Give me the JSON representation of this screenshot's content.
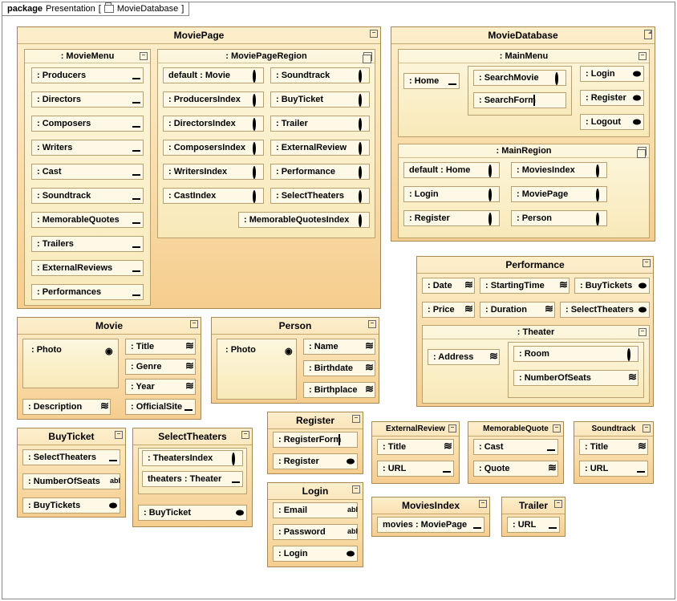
{
  "package": {
    "keyword": "package",
    "name": "Presentation",
    "context": "MovieDatabase"
  },
  "moviePage": {
    "title": "MoviePage",
    "menu": {
      "title": ": MovieMenu",
      "items": [
        ": Producers",
        ": Directors",
        ": Composers",
        ": Writers",
        ": Cast",
        ": Soundtrack",
        ": MemorableQuotes",
        ": Trailers",
        ": ExternalReviews",
        ": Performances"
      ]
    },
    "region": {
      "title": ": MoviePageRegion",
      "col1": [
        "default : Movie",
        ": ProducersIndex",
        ": DirectorsIndex",
        ": ComposersIndex",
        ": WritersIndex",
        ": CastIndex"
      ],
      "col2": [
        ": Soundtrack",
        ": BuyTicket",
        ": Trailer",
        ": ExternalReview",
        ": Performance",
        ": SelectTheaters",
        ": MemorableQuotesIndex"
      ]
    }
  },
  "movieDatabase": {
    "title": "MovieDatabase",
    "mainMenu": {
      "title": ": MainMenu",
      "home": ": Home",
      "searchMovie": ": SearchMovie",
      "searchForm": ": SearchForm",
      "right": [
        ": Login",
        ": Register",
        ": Logout"
      ]
    },
    "mainRegion": {
      "title": ": MainRegion",
      "col1": [
        "default : Home",
        ": Login",
        ": Register"
      ],
      "col2": [
        ": MoviesIndex",
        ": MoviePage",
        ": Person"
      ]
    }
  },
  "movie": {
    "title": "Movie",
    "photo": ": Photo",
    "title2": ": Title",
    "genre": ": Genre",
    "year": ": Year",
    "desc": ": Description",
    "site": ": OfficialSite"
  },
  "person": {
    "title": "Person",
    "photo": ": Photo",
    "name": ": Name",
    "birthdate": ": Birthdate",
    "birthplace": ": Birthplace"
  },
  "performance": {
    "title": "Performance",
    "date": ": Date",
    "start": ": StartingTime",
    "buy": ": BuyTickets",
    "price": ": Price",
    "duration": ": Duration",
    "select": ": SelectTheaters",
    "theater": {
      "title": ": Theater",
      "address": ": Address",
      "room": ": Room",
      "seats": ": NumberOfSeats"
    }
  },
  "buyTicket": {
    "title": "BuyTicket",
    "select": ": SelectTheaters",
    "seats": ": NumberOfSeats",
    "buy": ": BuyTickets"
  },
  "selectTheaters": {
    "title": "SelectTheaters",
    "index": ": TheatersIndex",
    "theaters": "theaters : Theater",
    "buy": ": BuyTicket"
  },
  "register": {
    "title": "Register",
    "form": ": RegisterForm",
    "btn": ": Register"
  },
  "login": {
    "title": "Login",
    "email": ": Email",
    "password": ": Password",
    "btn": ": Login"
  },
  "externalReview": {
    "title": "ExternalReview",
    "titlef": ": Title",
    "url": ": URL"
  },
  "memorableQuote": {
    "title": "MemorableQuote",
    "cast": ": Cast",
    "quote": ": Quote"
  },
  "soundtrack": {
    "title": "Soundtrack",
    "titlef": ": Title",
    "url": ": URL"
  },
  "moviesIndex": {
    "title": "MoviesIndex",
    "movies": "movies : MoviePage"
  },
  "trailer": {
    "title": "Trailer",
    "url": ": URL"
  }
}
